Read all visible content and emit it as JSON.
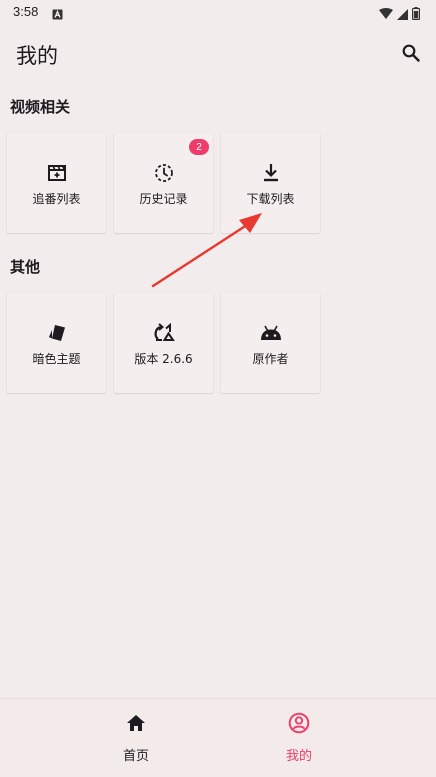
{
  "status_bar": {
    "time": "3:58",
    "icons": [
      "a-notification-icon",
      "wifi-icon",
      "cellular-signal-icon",
      "battery-icon"
    ]
  },
  "header": {
    "title": "我的",
    "search_icon": "search-icon"
  },
  "sections": [
    {
      "title": "视频相关",
      "items": [
        {
          "label": "追番列表",
          "icon": "subscribed-list-icon"
        },
        {
          "label": "历史记录",
          "icon": "history-icon",
          "badge": "2"
        },
        {
          "label": "下载列表",
          "icon": "download-icon"
        }
      ]
    },
    {
      "title": "其他",
      "items": [
        {
          "label": "暗色主题",
          "icon": "dark-theme-icon"
        },
        {
          "label": "版本 2.6.6",
          "icon": "version-icon"
        },
        {
          "label": "原作者",
          "icon": "android-icon"
        }
      ]
    }
  ],
  "bottom_nav": [
    {
      "label": "首页",
      "icon": "home-icon",
      "active": false
    },
    {
      "label": "我的",
      "icon": "profile-icon",
      "active": true
    }
  ],
  "colors": {
    "background": "#f3ecec",
    "accent": "#ee3d6a",
    "badge": "#ee3d6a",
    "annotation_arrow": "#e8382f",
    "text": "#1c1b1f"
  }
}
